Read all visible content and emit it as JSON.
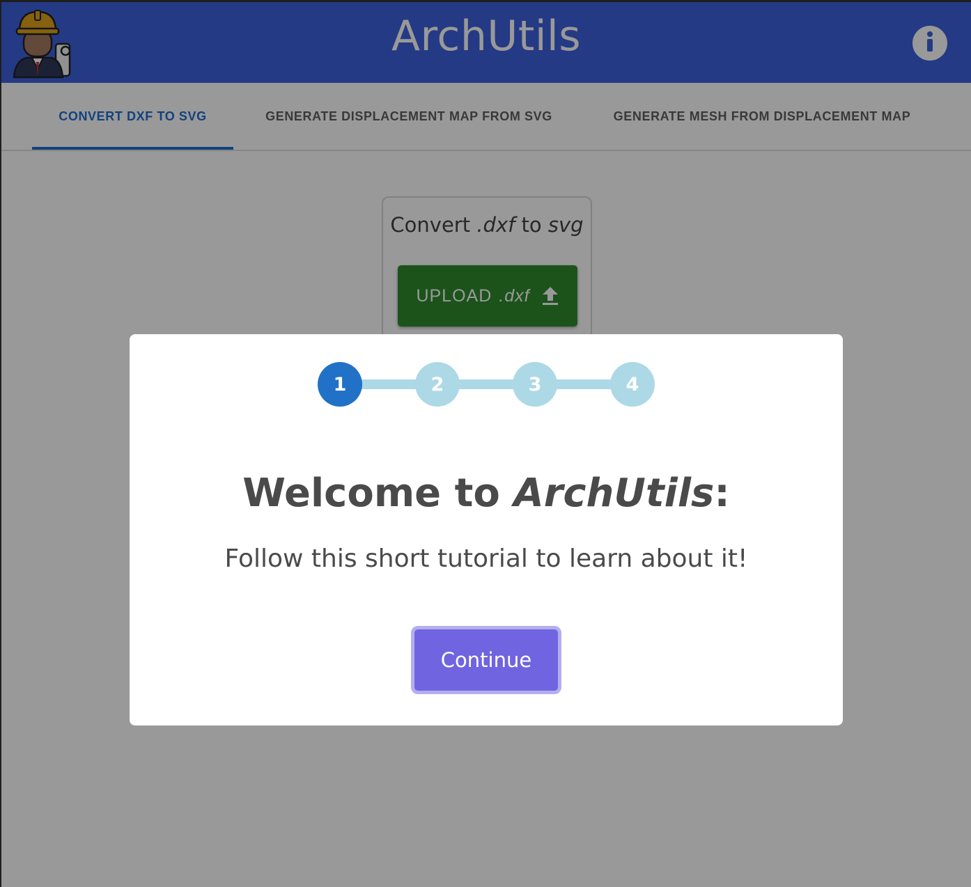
{
  "header": {
    "title": "ArchUtils",
    "logo_icon": "architect-avatar-icon",
    "info_icon": "info-icon",
    "brand_color": "#3f62de"
  },
  "tabs": [
    {
      "label": "CONVERT DXF TO SVG",
      "active": true
    },
    {
      "label": "GENERATE DISPLACEMENT MAP FROM SVG",
      "active": false
    },
    {
      "label": "GENERATE MESH FROM DISPLACEMENT MAP",
      "active": false
    }
  ],
  "converter": {
    "title_prefix": "Convert ",
    "title_ext": ".dxf",
    "title_mid": " to ",
    "title_target": "svg",
    "upload_label": "UPLOAD",
    "upload_ext": ".dxf",
    "upload_icon": "upload-icon",
    "button_color": "#2e8b2e"
  },
  "tutorial": {
    "steps": [
      "1",
      "2",
      "3",
      "4"
    ],
    "current_step": 1,
    "title_prefix": "Welcome to ",
    "title_app": "ArchUtils",
    "title_suffix": ":",
    "message": "Follow this short tutorial to learn about it!",
    "continue_label": "Continue",
    "continue_color": "#7064e0"
  }
}
